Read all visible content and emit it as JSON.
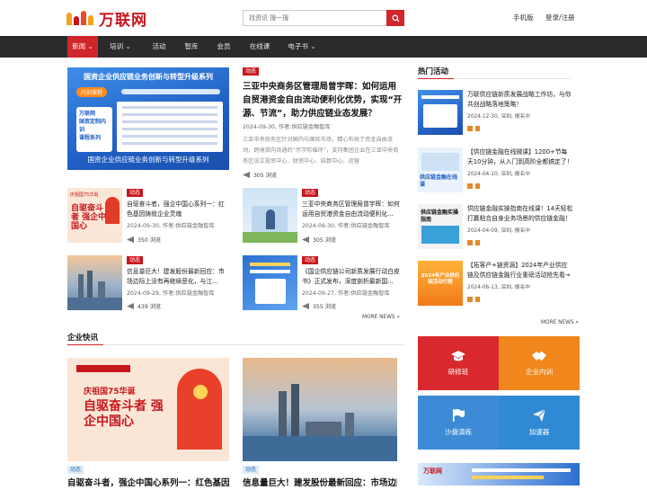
{
  "header": {
    "logo_text": "万联网",
    "logo_mark": "10CC",
    "search_placeholder": "找资讯 搜一搜",
    "mobile_link": "手机版",
    "login_link": "登录/注册"
  },
  "nav": {
    "items": [
      {
        "label": "新闻 ⌄",
        "active": true
      },
      {
        "label": "培训 ⌄",
        "active": false
      },
      {
        "label": "活动",
        "active": false
      },
      {
        "label": "智库",
        "active": false
      },
      {
        "label": "会员",
        "active": false
      },
      {
        "label": "在线课",
        "active": false
      },
      {
        "label": "电子书 ⌄",
        "active": false
      }
    ]
  },
  "featured": {
    "banner_title": "国资企业供应链业务创新与转型升级系列",
    "banner_caption": "国资企业供应链业务创新与转型升级系列",
    "banner_badge": "内训课程",
    "banner_side": [
      "万联网",
      "国资定制内训",
      "课程系列"
    ],
    "tag": "动态",
    "title": "三亚中央商务区管理局曾宇晖：如何运用自贸港资金自由流动便利化优势，实现“开源、节流”，助力供应链业态发展？",
    "meta": "2024-09-30, 作者:供应链金融智库",
    "desc": "三亚中央商务区针对国内与国际市场，精心布局了资金自由流动，跨境双向流通的“示字形循环”，支持集团企业在三亚中央商务区设立投资中心、财资中心、结算中心、运营",
    "views": "305 浏览"
  },
  "articles": [
    {
      "tag": "动态",
      "title": "自驱奋斗者，强企中国心系列一：红色基因铸就企业灵魂",
      "meta": "2024-09-30, 作者:供应链金融智库",
      "views": "350 浏览",
      "img_text": "自驱奋斗者 强企中国心",
      "img_sub": "庆祖国75华诞"
    },
    {
      "tag": "动态",
      "title": "三亚中央商务区管理局曾宇晖：如何运用自贸港资金自由流动便利化...",
      "meta": "2024-09-30, 作者:供应链金融智库",
      "views": "305 浏览"
    },
    {
      "tag": "动态",
      "title": "信息量巨大！建发股份最新回应：市场边际上没有再继续恶化，与江...",
      "meta": "2024-09-29, 作者:供应链金融智库",
      "views": "439 浏览"
    },
    {
      "tag": "动态",
      "title": "《国企供应链公司新质发展行动白皮书》正式发布，深度剖析最新国...",
      "meta": "2024-09-27, 作者:供应链金融智库",
      "views": "355 浏览"
    }
  ],
  "more_news": "MORE NEWS »",
  "enterprise": {
    "title": "企业快讯",
    "cards": [
      {
        "tag": "动态",
        "title": "自驱奋斗者，强企中国心系列一：红色基因铸就企业灵魂",
        "img_text": "自驱奋斗者 强企中国心",
        "img_sub": "庆祖国75华诞"
      },
      {
        "tag": "动态",
        "title": "信息量巨大！建发股份最新回应：市场边际上没有再继续恶化"
      }
    ]
  },
  "hot": {
    "title": "热门活动",
    "items": [
      {
        "title": "万联供应链新质发展战略工作坊，与你共创战略落地策略！",
        "meta": "2024-12-30, 深圳, 报名中"
      },
      {
        "title": "【供应链金融在线微课】1200+节每天10分钟，从入门到高阶全都搞定了！",
        "meta": "2024-04-10, 深圳, 报名中",
        "img_text": "供应链金融在线课"
      },
      {
        "title": "供应链金融实操指南在线课！14天轻松打赢粘合自身业务场景的供应链金融！",
        "meta": "2024-04-09, 深圳, 报名中",
        "img_text": "供应链金融实操指南"
      },
      {
        "title": "【拓客产+链资源】2024年产业供应链及供应链金融行业重磅活动抢先看→",
        "meta": "2024-06-13, 深圳, 报名中",
        "img_text": "2024年产业供应链活动行程"
      }
    ],
    "more": "MORE NEWS »"
  },
  "tiles": [
    {
      "label": "研修班",
      "icon": "graduation-cap-icon",
      "color": "#d9282e"
    },
    {
      "label": "企业内训",
      "icon": "handshake-icon",
      "color": "#f0861c"
    },
    {
      "label": "沙盘演练",
      "icon": "flag-icon",
      "color": "#3d8bd6"
    },
    {
      "label": "加速器",
      "icon": "paper-plane-icon",
      "color": "#2f89d3"
    }
  ],
  "bottom_banner_logo": "万联网"
}
